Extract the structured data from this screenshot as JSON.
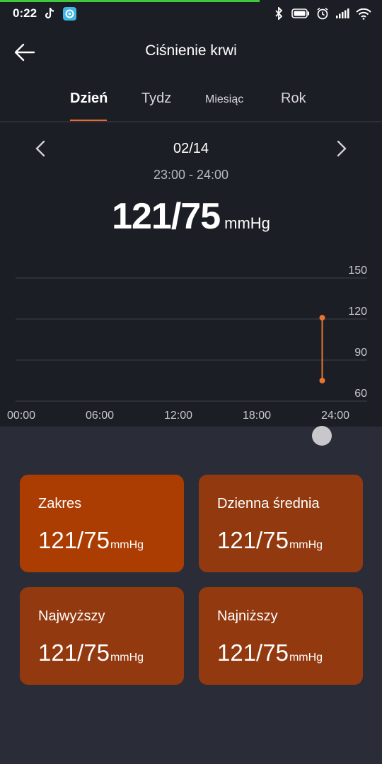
{
  "status_bar": {
    "time": "0:22",
    "icons_left": [
      "tiktok-icon",
      "app-icon"
    ],
    "icons_right": [
      "bluetooth-icon",
      "battery-icon",
      "alarm-icon",
      "signal-icon",
      "wifi-icon"
    ]
  },
  "header": {
    "title": "Ciśnienie krwi",
    "back_icon": "arrow-left-icon"
  },
  "tabs": [
    {
      "label": "Dzień",
      "active": true
    },
    {
      "label": "Tydz",
      "active": false
    },
    {
      "label": "Miesiąc",
      "active": false
    },
    {
      "label": "Rok",
      "active": false
    }
  ],
  "date_nav": {
    "date": "02/14",
    "time_range": "23:00 - 24:00",
    "prev_icon": "chevron-left-icon",
    "next_icon": "chevron-right-icon"
  },
  "reading": {
    "value": "121/75",
    "unit": "mmHg"
  },
  "chart_data": {
    "type": "range",
    "x_ticks": [
      "00:00",
      "06:00",
      "12:00",
      "18:00",
      "24:00"
    ],
    "y_ticks": [
      "150",
      "120",
      "90",
      "60"
    ],
    "xlim": [
      0,
      24
    ],
    "ylim": [
      60,
      150
    ],
    "grid": true,
    "series": [
      {
        "x": 23.0,
        "systolic": 121,
        "diastolic": 75
      }
    ],
    "accent_color": "#e8742f"
  },
  "cards": [
    {
      "label": "Zakres",
      "value": "121/75",
      "unit": "mmHg"
    },
    {
      "label": "Dzienna średnia",
      "value": "121/75",
      "unit": "mmHg"
    },
    {
      "label": "Najwyższy",
      "value": "121/75",
      "unit": "mmHg"
    },
    {
      "label": "Najniższy",
      "value": "121/75",
      "unit": "mmHg"
    }
  ],
  "colors": {
    "background_top": "#1c1e25",
    "background_bottom": "#2a2d38",
    "accent": "#e86a2c",
    "card_primary": "#ab3c02",
    "card": "#93390f"
  }
}
